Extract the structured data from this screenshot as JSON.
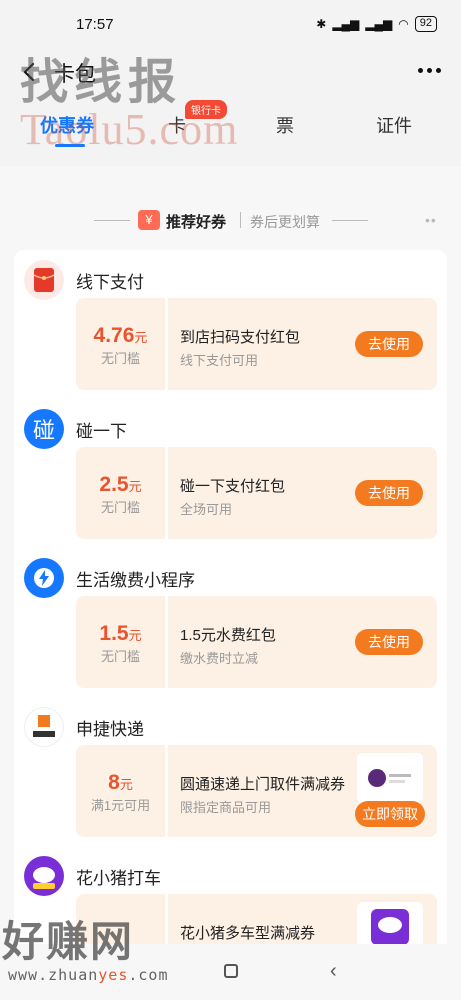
{
  "status": {
    "time": "17:57",
    "battery": "92"
  },
  "header": {
    "title": "卡包"
  },
  "watermark": {
    "top": "找线报",
    "top2": "Taolu5.com",
    "bottom": "好赚网",
    "url_prefix": "www.zhuan",
    "url_accent": "yes",
    "url_suffix": ".com"
  },
  "tabs": [
    {
      "label": "优惠券"
    },
    {
      "label": "卡"
    },
    {
      "label": "票"
    },
    {
      "label": "证件"
    }
  ],
  "tab_badge": "银行卡",
  "section": {
    "title": "推荐好券",
    "subtitle": "券后更划算",
    "icon": "¥"
  },
  "groups": [
    {
      "merchant": "线下支付",
      "amount": "4.76",
      "unit": "元",
      "condition": "无门槛",
      "title": "到店扫码支付红包",
      "subtitle": "线下支付可用",
      "button": "去使用"
    },
    {
      "merchant": "碰一下",
      "amount": "2.5",
      "unit": "元",
      "condition": "无门槛",
      "title": "碰一下支付红包",
      "subtitle": "全场可用",
      "button": "去使用",
      "icon_text": "碰"
    },
    {
      "merchant": "生活缴费小程序",
      "amount": "1.5",
      "unit": "元",
      "condition": "无门槛",
      "title": "1.5元水费红包",
      "subtitle": "缴水费时立减",
      "button": "去使用"
    },
    {
      "merchant": "申捷快递",
      "amount": "8",
      "unit": "元",
      "condition": "满1元可用",
      "title": "圆通速递上门取件满减券",
      "subtitle": "限指定商品可用",
      "button": "立即领取"
    },
    {
      "merchant": "花小猪打车",
      "amount": "",
      "unit": "",
      "condition": "",
      "title": "花小猪多车型满减券",
      "subtitle": "",
      "button": ""
    }
  ],
  "colors": {
    "accent": "#1677ff",
    "orange": "#f47a1f",
    "price": "#e9532d"
  }
}
